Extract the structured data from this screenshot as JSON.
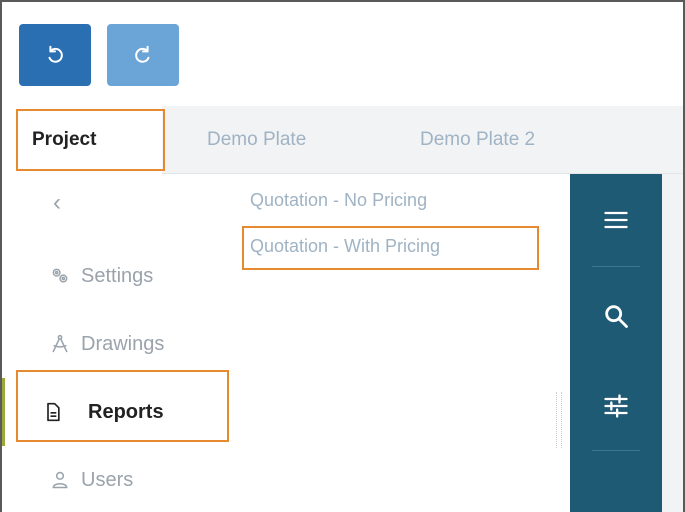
{
  "toolbar": {
    "undo_icon": "undo-icon",
    "redo_icon": "redo-icon"
  },
  "tabs": [
    {
      "label": "Project",
      "active": true
    },
    {
      "label": "Demo Plate",
      "active": false
    },
    {
      "label": "Demo Plate 2",
      "active": false
    }
  ],
  "sidebar": {
    "back_icon": "chevron-left-icon",
    "back_glyph": "‹",
    "items": [
      {
        "label": "Settings",
        "icon": "settings-icon"
      },
      {
        "label": "Drawings",
        "icon": "drawings-icon"
      },
      {
        "label": "Reports",
        "icon": "report-file-icon",
        "active": true
      },
      {
        "label": "Users",
        "icon": "user-icon"
      }
    ]
  },
  "reports": [
    {
      "label": "Quotation - No Pricing"
    },
    {
      "label": "Quotation - With Pricing"
    }
  ],
  "rail": {
    "icons": [
      "menu-icon",
      "search-icon",
      "filter-sliders-icon"
    ]
  },
  "colors": {
    "undo": "#2a6fb2",
    "redo": "#6ba4d6",
    "rail": "#1f5a74",
    "highlight": "#e58a2e",
    "active_accent": "#9aa83d"
  }
}
